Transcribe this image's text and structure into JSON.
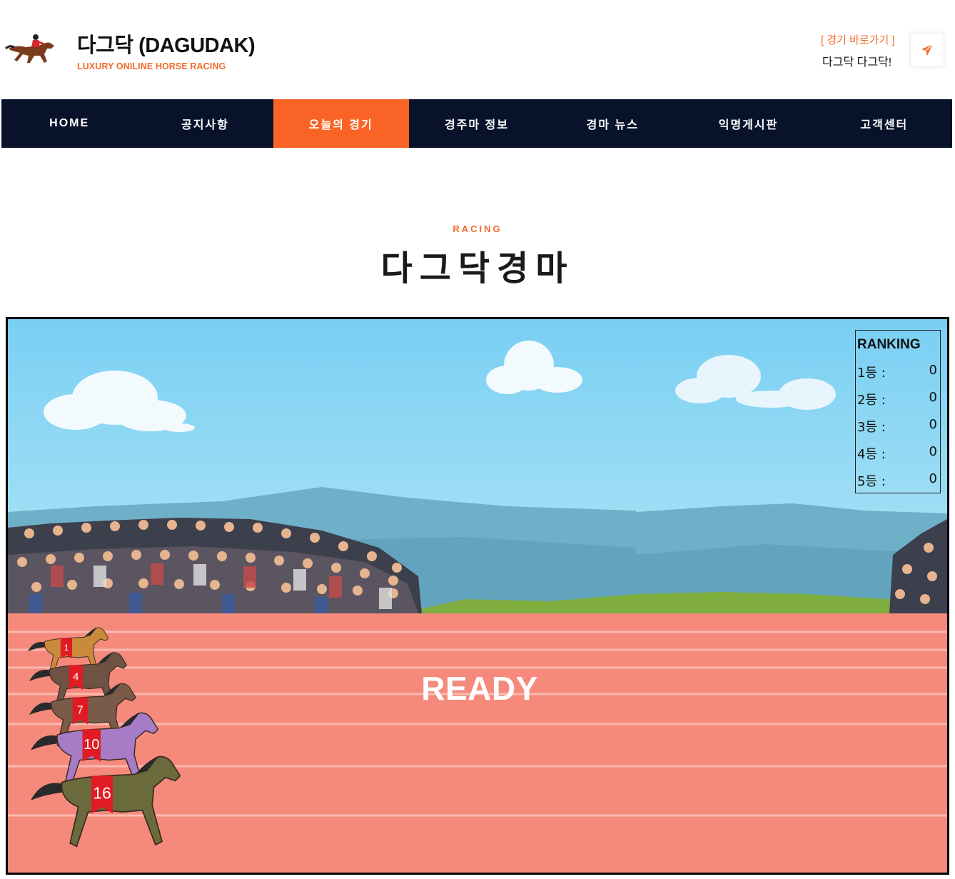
{
  "header": {
    "brand_title": "다그닥 (DAGUDAK)",
    "brand_subtitle": "LUXURY ONILINE HORSE RACING",
    "shortcut_label": "[ 경기 바로가기 ]",
    "shortcut_sub": "다그닥 다그닥!",
    "send_icon": "paper-plane-icon"
  },
  "nav": {
    "items": [
      {
        "label": "HOME"
      },
      {
        "label": "공지사항"
      },
      {
        "label": "오늘의 경기",
        "active": true
      },
      {
        "label": "경주마 정보"
      },
      {
        "label": "경마 뉴스"
      },
      {
        "label": "익명게시판"
      },
      {
        "label": "고객센터"
      }
    ]
  },
  "section": {
    "label": "RACING",
    "title": "다그닥경마"
  },
  "game": {
    "ranking": {
      "title": "RANKING",
      "rows": [
        {
          "label": "1등 :",
          "value": "0"
        },
        {
          "label": "2등 :",
          "value": "0"
        },
        {
          "label": "3등 :",
          "value": "0"
        },
        {
          "label": "4등 :",
          "value": "0"
        },
        {
          "label": "5등 :",
          "value": "0"
        }
      ]
    },
    "status_text": "READY",
    "horses": [
      {
        "number": "1",
        "color": "#c98a3a"
      },
      {
        "number": "4",
        "color": "#6e5244"
      },
      {
        "number": "7",
        "color": "#7a5a48"
      },
      {
        "number": "10",
        "color": "#a77cc6"
      },
      {
        "number": "16",
        "color": "#6a6a3c"
      }
    ]
  },
  "colors": {
    "accent": "#f96426",
    "nav_bg": "#08122b",
    "track": "#f58a7c",
    "sky": "#86d4f4"
  }
}
